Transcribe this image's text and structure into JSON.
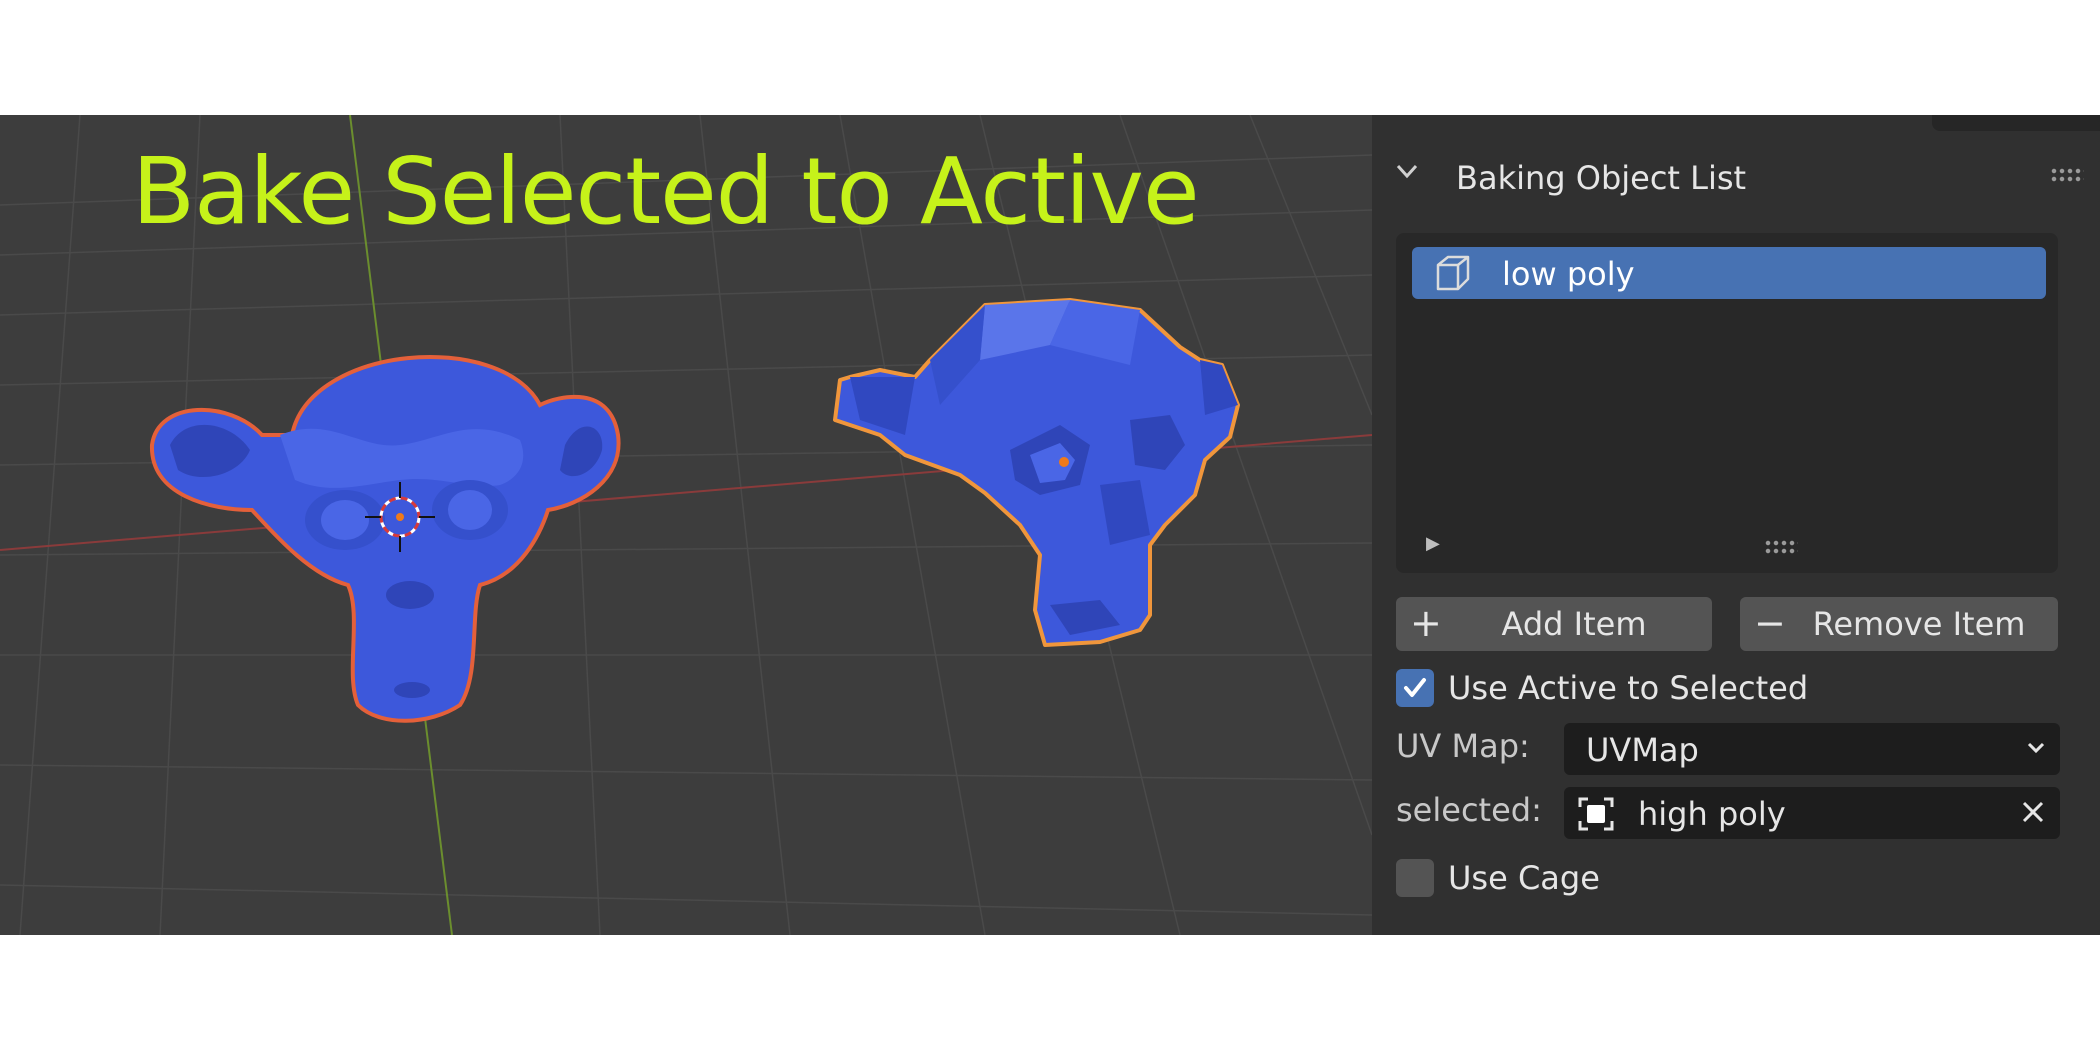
{
  "banner": {
    "text": "Bake Selected to Active"
  },
  "panel": {
    "title": "Baking Object List",
    "list": {
      "items": [
        {
          "label": "low poly",
          "icon": "mesh-cube-icon",
          "selected": true
        }
      ]
    },
    "buttons": {
      "add": "Add Item",
      "remove": "Remove Item"
    },
    "use_active_to_selected": {
      "label": "Use Active to Selected",
      "checked": true
    },
    "uv_map": {
      "label": "UV Map:",
      "value": "UVMap"
    },
    "selected": {
      "label": "selected:",
      "value": "high poly"
    },
    "use_cage": {
      "label": "Use Cage",
      "checked": false
    }
  },
  "colors": {
    "banner": "#c6f21a",
    "accent_blue": "#4772b3",
    "mesh_blue": "#3d58db",
    "selection_outline_red": "#e4603a",
    "selection_outline_orange": "#f0963c",
    "viewport_bg": "#3d3d3d",
    "panel_bg": "#303030"
  }
}
